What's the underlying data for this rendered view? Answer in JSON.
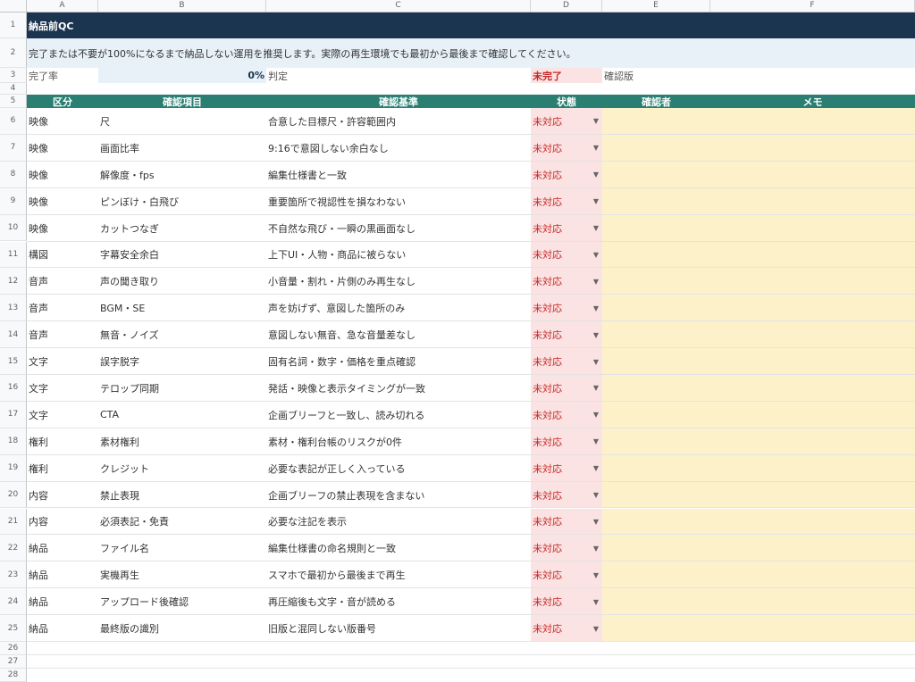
{
  "columns": [
    "A",
    "B",
    "C",
    "D",
    "E",
    "F"
  ],
  "title": "納品前QC",
  "notice": "完了または不要が100%になるまで納品しない運用を推奨します。実際の再生環境でも最初から最後まで確認してください。",
  "summary": {
    "rate_label": "完了率",
    "rate_value": "0%",
    "judge_label": "判定",
    "judge_value": "未完了",
    "confirmed_label": "確認版"
  },
  "headers": [
    "区分",
    "確認項目",
    "確認基準",
    "状態",
    "確認者",
    "メモ"
  ],
  "rows": [
    {
      "n": "6",
      "cat": "映像",
      "item": "尺",
      "criteria": "合意した目標尺・許容範囲内",
      "status": "未対応"
    },
    {
      "n": "7",
      "cat": "映像",
      "item": "画面比率",
      "criteria": "9:16で意図しない余白なし",
      "status": "未対応"
    },
    {
      "n": "8",
      "cat": "映像",
      "item": "解像度・fps",
      "criteria": "編集仕様書と一致",
      "status": "未対応"
    },
    {
      "n": "9",
      "cat": "映像",
      "item": "ピンぼけ・白飛び",
      "criteria": "重要箇所で視認性を損なわない",
      "status": "未対応"
    },
    {
      "n": "10",
      "cat": "映像",
      "item": "カットつなぎ",
      "criteria": "不自然な飛び・一瞬の黒画面なし",
      "status": "未対応"
    },
    {
      "n": "11",
      "cat": "構図",
      "item": "字幕安全余白",
      "criteria": "上下UI・人物・商品に被らない",
      "status": "未対応"
    },
    {
      "n": "12",
      "cat": "音声",
      "item": "声の聞き取り",
      "criteria": "小音量・割れ・片側のみ再生なし",
      "status": "未対応"
    },
    {
      "n": "13",
      "cat": "音声",
      "item": "BGM・SE",
      "criteria": "声を妨げず、意図した箇所のみ",
      "status": "未対応"
    },
    {
      "n": "14",
      "cat": "音声",
      "item": "無音・ノイズ",
      "criteria": "意図しない無音、急な音量差なし",
      "status": "未対応"
    },
    {
      "n": "15",
      "cat": "文字",
      "item": "誤字脱字",
      "criteria": "固有名詞・数字・価格を重点確認",
      "status": "未対応"
    },
    {
      "n": "16",
      "cat": "文字",
      "item": "テロップ同期",
      "criteria": "発話・映像と表示タイミングが一致",
      "status": "未対応"
    },
    {
      "n": "17",
      "cat": "文字",
      "item": "CTA",
      "criteria": "企画ブリーフと一致し、読み切れる",
      "status": "未対応"
    },
    {
      "n": "18",
      "cat": "権利",
      "item": "素材権利",
      "criteria": "素材・権利台帳のリスクが0件",
      "status": "未対応"
    },
    {
      "n": "19",
      "cat": "権利",
      "item": "クレジット",
      "criteria": "必要な表記が正しく入っている",
      "status": "未対応"
    },
    {
      "n": "20",
      "cat": "内容",
      "item": "禁止表現",
      "criteria": "企画ブリーフの禁止表現を含まない",
      "status": "未対応"
    },
    {
      "n": "21",
      "cat": "内容",
      "item": "必須表記・免責",
      "criteria": "必要な注記を表示",
      "status": "未対応"
    },
    {
      "n": "22",
      "cat": "納品",
      "item": "ファイル名",
      "criteria": "編集仕様書の命名規則と一致",
      "status": "未対応"
    },
    {
      "n": "23",
      "cat": "納品",
      "item": "実機再生",
      "criteria": "スマホで最初から最後まで再生",
      "status": "未対応"
    },
    {
      "n": "24",
      "cat": "納品",
      "item": "アップロード後確認",
      "criteria": "再圧縮後も文字・音が読める",
      "status": "未対応"
    },
    {
      "n": "25",
      "cat": "納品",
      "item": "最終版の識別",
      "criteria": "旧版と混同しない版番号",
      "status": "未対応"
    }
  ],
  "row_numbers_top": [
    "1",
    "2",
    "3",
    "4",
    "5"
  ],
  "row_numbers_bottom": [
    "26",
    "27",
    "28"
  ],
  "dropdown_icon": "triangle-down",
  "colors": {
    "title_bg": "#1b3550",
    "header_bg": "#2a7f72",
    "status_bg": "#fbe3e3",
    "status_text": "#c62828",
    "memo_bg": "#fdf1c9",
    "notice_bg": "#e8f0f8"
  }
}
